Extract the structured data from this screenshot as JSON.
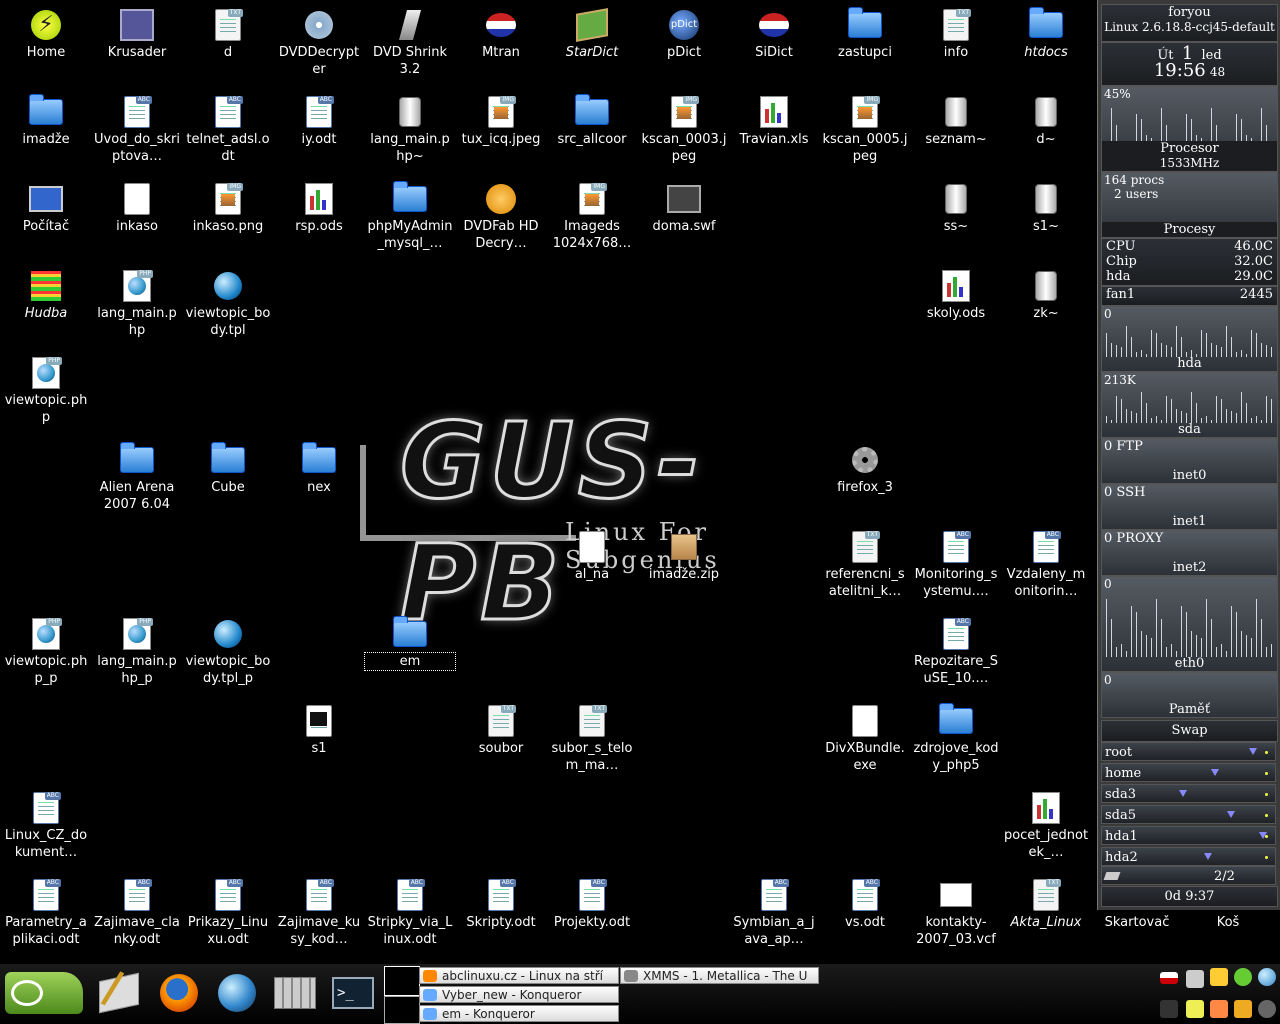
{
  "desktop_icons": [
    {
      "label": "Home",
      "icon": "lightning-icon"
    },
    {
      "label": "Krusader",
      "icon": "krusader-icon"
    },
    {
      "label": "d",
      "icon": "text-file-icon"
    },
    {
      "label": "DVDDecrypter",
      "icon": "dvd-icon"
    },
    {
      "label": "DVD Shrink 3.2",
      "icon": "dvd-shrink-icon"
    },
    {
      "label": "Mtran",
      "icon": "flag-icon"
    },
    {
      "label": "StarDict",
      "icon": "book-icon"
    },
    {
      "label": "pDict",
      "icon": "pdict-icon"
    },
    {
      "label": "SiDict",
      "icon": "flag-icon"
    },
    {
      "label": "zastupci",
      "icon": "folder-icon"
    },
    {
      "label": "info",
      "icon": "text-file-icon"
    },
    {
      "label": "htdocs",
      "icon": "folder-icon"
    },
    {
      "label": "imadže",
      "icon": "folder-icon"
    },
    {
      "label": "Uvod_do_skriptova…",
      "icon": "odt-document-icon"
    },
    {
      "label": "telnet_adsl.odt",
      "icon": "odt-document-icon"
    },
    {
      "label": "iy.odt",
      "icon": "odt-document-icon"
    },
    {
      "label": "lang_main.php~",
      "icon": "backup-file-icon"
    },
    {
      "label": "tux_icq.jpeg",
      "icon": "image-file-icon"
    },
    {
      "label": "src_allcoor",
      "icon": "folder-icon"
    },
    {
      "label": "kscan_0003.jpeg",
      "icon": "image-file-icon"
    },
    {
      "label": "Travian.xls",
      "icon": "spreadsheet-icon"
    },
    {
      "label": "kscan_0005.jpeg",
      "icon": "image-file-icon"
    },
    {
      "label": "seznam~",
      "icon": "backup-file-icon"
    },
    {
      "label": "d~",
      "icon": "backup-file-icon"
    },
    {
      "label": "Počítač",
      "icon": "computer-icon"
    },
    {
      "label": "inkaso",
      "icon": "blank-file-icon"
    },
    {
      "label": "inkaso.png",
      "icon": "image-file-icon"
    },
    {
      "label": "rsp.ods",
      "icon": "spreadsheet-icon"
    },
    {
      "label": "phpMyAdmin_mysql_…",
      "icon": "folder-icon"
    },
    {
      "label": "DVDFab HD Decry…",
      "icon": "dvdfab-icon"
    },
    {
      "label": "Imageds 1024x768…",
      "icon": "image-file-icon"
    },
    {
      "label": "doma.swf",
      "icon": "video-file-icon"
    },
    {
      "label": "ss~",
      "icon": "backup-file-icon"
    },
    {
      "label": "s1~",
      "icon": "backup-file-icon"
    },
    {
      "label": "Hudba",
      "icon": "equalizer-icon"
    },
    {
      "label": "lang_main.php",
      "icon": "php-file-icon"
    },
    {
      "label": "viewtopic_body.tpl",
      "icon": "globe-file-icon"
    },
    {
      "label": "skoly.ods",
      "icon": "spreadsheet-icon"
    },
    {
      "label": "zk~",
      "icon": "backup-file-icon"
    },
    {
      "label": "viewtopic.php",
      "icon": "php-file-icon"
    },
    {
      "label": "Alien Arena 2007 6.04",
      "icon": "folder-icon"
    },
    {
      "label": "Cube",
      "icon": "folder-icon"
    },
    {
      "label": "nex",
      "icon": "folder-icon"
    },
    {
      "label": "firefox_3",
      "icon": "gear-icon"
    },
    {
      "label": "al_na",
      "icon": "blank-file-icon"
    },
    {
      "label": "imadže.zip",
      "icon": "archive-icon"
    },
    {
      "label": "referencni_satelitni_k…",
      "icon": "text-file-icon"
    },
    {
      "label": "Monitoring_systemu.…",
      "icon": "odt-document-icon"
    },
    {
      "label": "Vzdaleny_monitorin…",
      "icon": "odt-document-icon"
    },
    {
      "label": "viewtopic.php_p",
      "icon": "php-file-icon"
    },
    {
      "label": "lang_main.php_p",
      "icon": "php-file-icon"
    },
    {
      "label": "viewtopic_body.tpl_p",
      "icon": "globe-file-icon"
    },
    {
      "label": "em",
      "icon": "folder-icon"
    },
    {
      "label": "Repozitare_SuSE_10.…",
      "icon": "odt-document-icon"
    },
    {
      "label": "s1",
      "icon": "terminal-script-icon"
    },
    {
      "label": "soubor",
      "icon": "text-file-icon"
    },
    {
      "label": "subor_s_telom_ma…",
      "icon": "text-file-icon"
    },
    {
      "label": "DivXBundle.exe",
      "icon": "blank-file-icon"
    },
    {
      "label": "zdrojove_kody_php5",
      "icon": "folder-icon"
    },
    {
      "label": "Linux_CZ_dokument…",
      "icon": "odt-document-icon"
    },
    {
      "label": "pocet_jednotek_…",
      "icon": "spreadsheet-icon"
    },
    {
      "label": "Parametry_aplikaci.odt",
      "icon": "odt-document-icon"
    },
    {
      "label": "Zajimave_clanky.odt",
      "icon": "odt-document-icon"
    },
    {
      "label": "Prikazy_Linuxu.odt",
      "icon": "odt-document-icon"
    },
    {
      "label": "Zajimave_kusy_kod…",
      "icon": "odt-document-icon"
    },
    {
      "label": "Stripky_via_Linux.odt",
      "icon": "odt-document-icon"
    },
    {
      "label": "Skripty.odt",
      "icon": "odt-document-icon"
    },
    {
      "label": "Projekty.odt",
      "icon": "odt-document-icon"
    },
    {
      "label": "Symbian_a_java_ap…",
      "icon": "odt-document-icon"
    },
    {
      "label": "vs.odt",
      "icon": "odt-document-icon"
    },
    {
      "label": "kontakty-2007_03.vcf",
      "icon": "vcard-icon"
    },
    {
      "label": "Akta_Linux",
      "icon": "text-file-icon"
    },
    {
      "label": "Skartovač",
      "icon": "shredder-icon"
    },
    {
      "label": "Koš",
      "icon": "trash-icon"
    }
  ],
  "wallpaper": {
    "title": "GUS-PB",
    "subtitle": "Linux For Subgenius"
  },
  "monitor": {
    "user": "foryou",
    "kernel": "Linux 2.6.18.8-ccj45-default",
    "day": "Út",
    "date_day": "1",
    "month": "led",
    "time": "19:56",
    "seconds": "48",
    "cpu_percent": "45%",
    "cpu_label": "Procesor",
    "cpu_freq": "1533MHz",
    "procs": "164 procs",
    "users": "2 users",
    "procs_label": "Procesy",
    "sensors": [
      {
        "name": "CPU",
        "value": "46.0C"
      },
      {
        "name": "Chip",
        "value": "32.0C"
      },
      {
        "name": "hda",
        "value": "29.0C"
      },
      {
        "name": "fan1",
        "value": "2445"
      }
    ],
    "hda_value": "0",
    "hda_label": "hda",
    "sda_value": "213K",
    "sda_label": "sda",
    "ftp": "0 FTP",
    "inet0": "inet0",
    "ssh": "0 SSH",
    "inet1": "inet1",
    "proxy": "0 PROXY",
    "inet2": "inet2",
    "eth0_value": "0",
    "eth0_label": "eth0",
    "mem_value": "0",
    "mem_label": "Paměť",
    "swap_label": "Swap",
    "mounts": [
      {
        "name": "root",
        "fill": 0.92
      },
      {
        "name": "home",
        "fill": 0.68
      },
      {
        "name": "sda3",
        "fill": 0.48
      },
      {
        "name": "sda5",
        "fill": 0.78
      },
      {
        "name": "hda1",
        "fill": 0.98
      },
      {
        "name": "hda2",
        "fill": 0.64
      }
    ],
    "mail": "2/2",
    "uptime": "0d  9:37"
  },
  "taskbar": {
    "launchers": [
      "suse-menu-icon",
      "kwrite-icon",
      "firefox-icon",
      "konqueror-globe-icon",
      "calculator-icon",
      "konsole-icon"
    ],
    "tasks": [
      {
        "label": "abclinuxu.cz - Linux na stří",
        "icon": "firefox-icon"
      },
      {
        "label": "Vyber_new - Konqueror",
        "icon": "folder-icon"
      },
      {
        "label": "em - Konqueror",
        "icon": "folder-icon"
      },
      {
        "label": "XMMS - 1. Metallica - The U",
        "icon": "xmms-icon"
      }
    ],
    "colors": {
      "accent": "#73ba25",
      "panel": "#2c3036"
    }
  }
}
